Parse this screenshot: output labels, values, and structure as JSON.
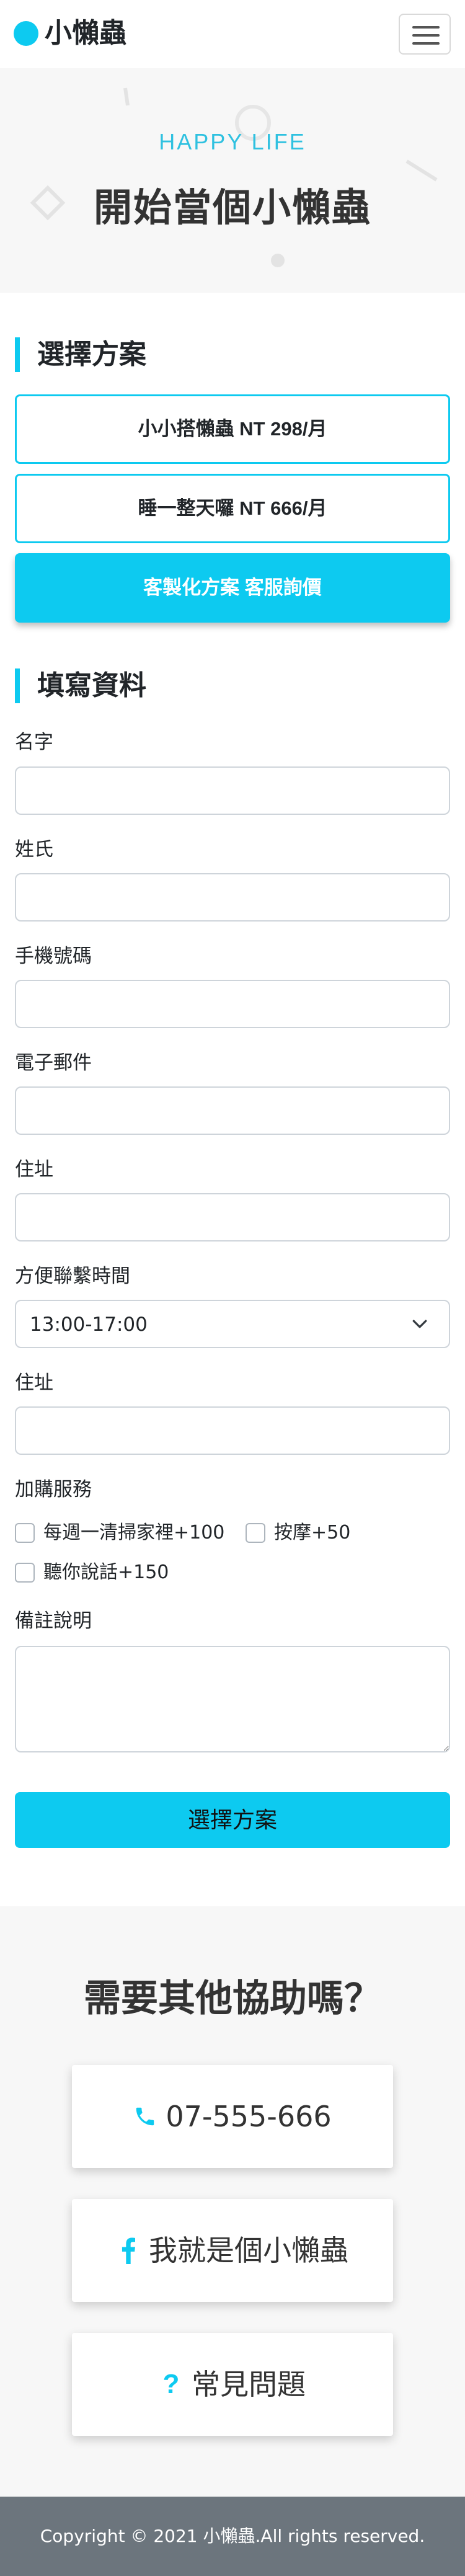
{
  "brand": {
    "name": "小懶蟲"
  },
  "nav": {
    "toggle_icon": "hamburger-menu-icon"
  },
  "hero": {
    "subtitle": "HAPPY LIFE",
    "title": "開始當個小懶蟲"
  },
  "plans": {
    "heading": "選擇方案",
    "items": [
      {
        "label": "小小搭懶蟲 NT 298/月"
      },
      {
        "label": "睡一整天囉 NT 666/月"
      },
      {
        "label": "客製化方案 客服詢價"
      }
    ]
  },
  "form": {
    "heading": "填寫資料",
    "fields": {
      "first_name": {
        "label": "名字",
        "value": ""
      },
      "last_name": {
        "label": "姓氏",
        "value": ""
      },
      "phone": {
        "label": "手機號碼",
        "value": ""
      },
      "email": {
        "label": "電子郵件",
        "value": ""
      },
      "address": {
        "label": "住址",
        "value": ""
      },
      "contact_time": {
        "label": "方便聯繫時間",
        "value": "13:00-17:00"
      },
      "address2": {
        "label": "住址",
        "value": ""
      }
    },
    "extras": {
      "label": "加購服務",
      "options": [
        {
          "label": "每週一清掃家裡+100",
          "checked": false
        },
        {
          "label": "按摩+50",
          "checked": false
        },
        {
          "label": "聽你說話+150",
          "checked": false
        }
      ]
    },
    "notes": {
      "label": "備註說明",
      "value": ""
    },
    "submit_label": "選擇方案"
  },
  "help": {
    "title": "需要其他協助嗎？",
    "items": [
      {
        "icon": "phone-icon",
        "label": "07-555-666"
      },
      {
        "icon": "facebook-icon",
        "label": "我就是個小懶蟲"
      },
      {
        "icon": "question-icon",
        "label": "常見問題"
      }
    ]
  },
  "footer": {
    "text": "Copyright © 2021 小懶蟲.All rights reserved."
  },
  "colors": {
    "accent": "#0dcaf0",
    "footer": "#6c757d",
    "hero_bg": "#f7f7f7"
  }
}
